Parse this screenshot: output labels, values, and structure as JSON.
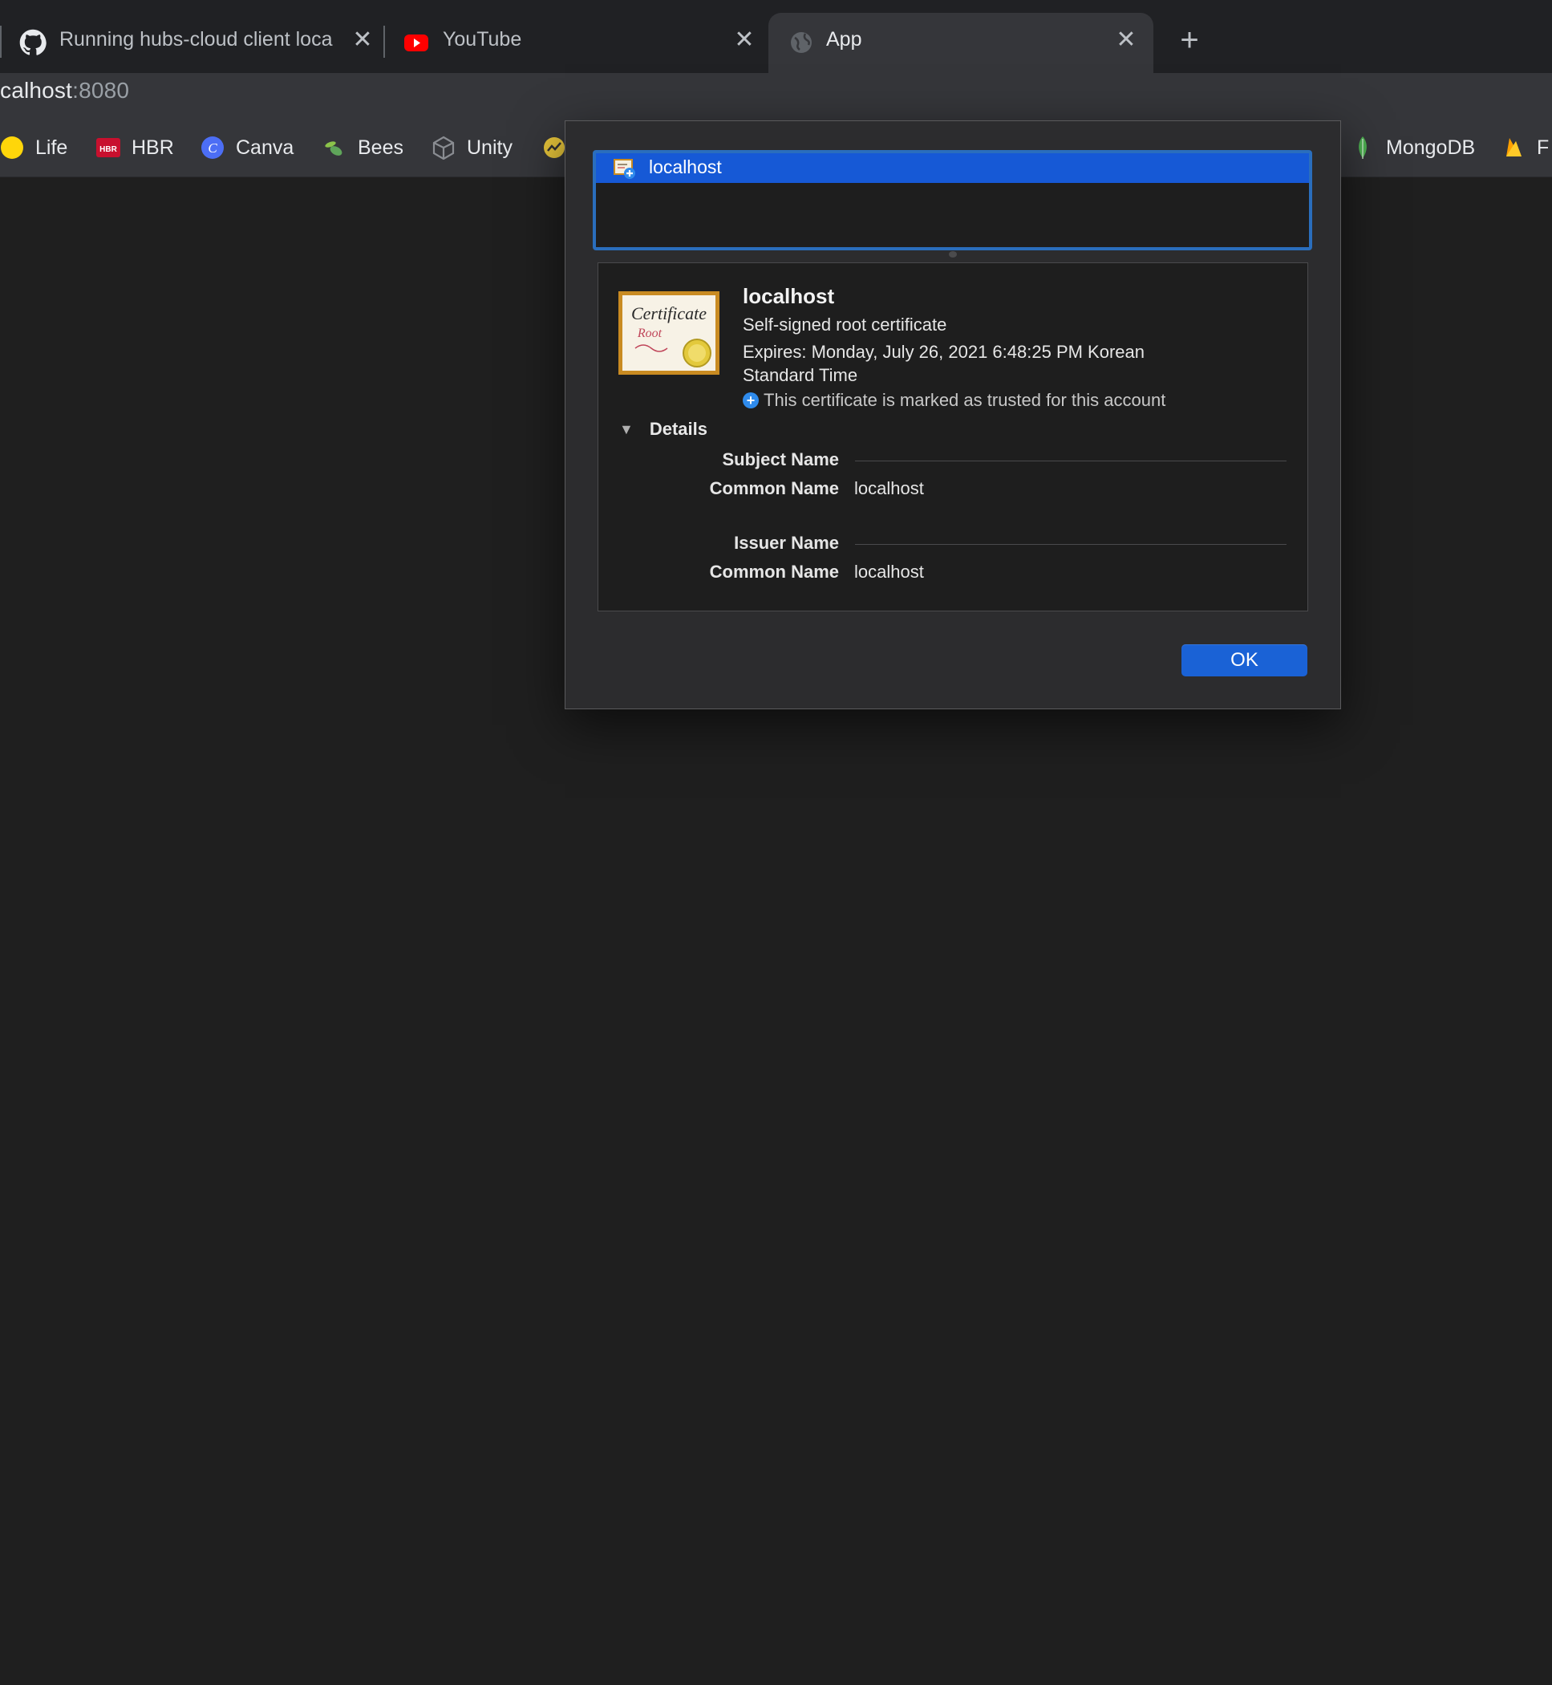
{
  "browser": {
    "tabs": [
      {
        "title": "Running hubs-cloud client loca",
        "icon": "github-icon",
        "close": "✕"
      },
      {
        "title": "YouTube",
        "icon": "youtube-icon",
        "close": "✕"
      },
      {
        "title": "App",
        "icon": "globe-icon",
        "close": "✕",
        "active": true
      }
    ],
    "new_tab": "+",
    "address": {
      "host": "calhost",
      "port": ":8080"
    },
    "bookmarks": [
      {
        "label": "Life",
        "icon": "yellow-dot-icon"
      },
      {
        "label": "HBR",
        "icon": "hbr-icon"
      },
      {
        "label": "Canva",
        "icon": "canva-icon"
      },
      {
        "label": "Bees",
        "icon": "bee-icon"
      },
      {
        "label": "Unity",
        "icon": "unity-icon"
      },
      {
        "label": "MongoDB",
        "icon": "mongodb-leaf-icon"
      },
      {
        "label": "F",
        "icon": "firebase-icon"
      }
    ]
  },
  "dialog": {
    "list_items": [
      {
        "label": "localhost",
        "icon": "certificate-small-icon",
        "selected": true
      }
    ],
    "cert": {
      "name": "localhost",
      "kind": "Self-signed root certificate",
      "expires": "Expires: Monday, July 26, 2021 6:48:25 PM Korean Standard Time",
      "trust_note": "This certificate is marked as trusted for this account",
      "image_text": {
        "line1": "Certificate",
        "line2": "Root"
      }
    },
    "details": {
      "toggle_label": "Details",
      "sections": [
        {
          "heading": "Subject Name",
          "fields": [
            {
              "label": "Common Name",
              "value": "localhost"
            }
          ]
        },
        {
          "heading": "Issuer Name",
          "fields": [
            {
              "label": "Common Name",
              "value": "localhost"
            }
          ]
        }
      ]
    },
    "ok_label": "OK"
  },
  "colors": {
    "accent": "#1a62d6",
    "selection": "#1659d6",
    "focus_ring": "#2a6ebd"
  }
}
